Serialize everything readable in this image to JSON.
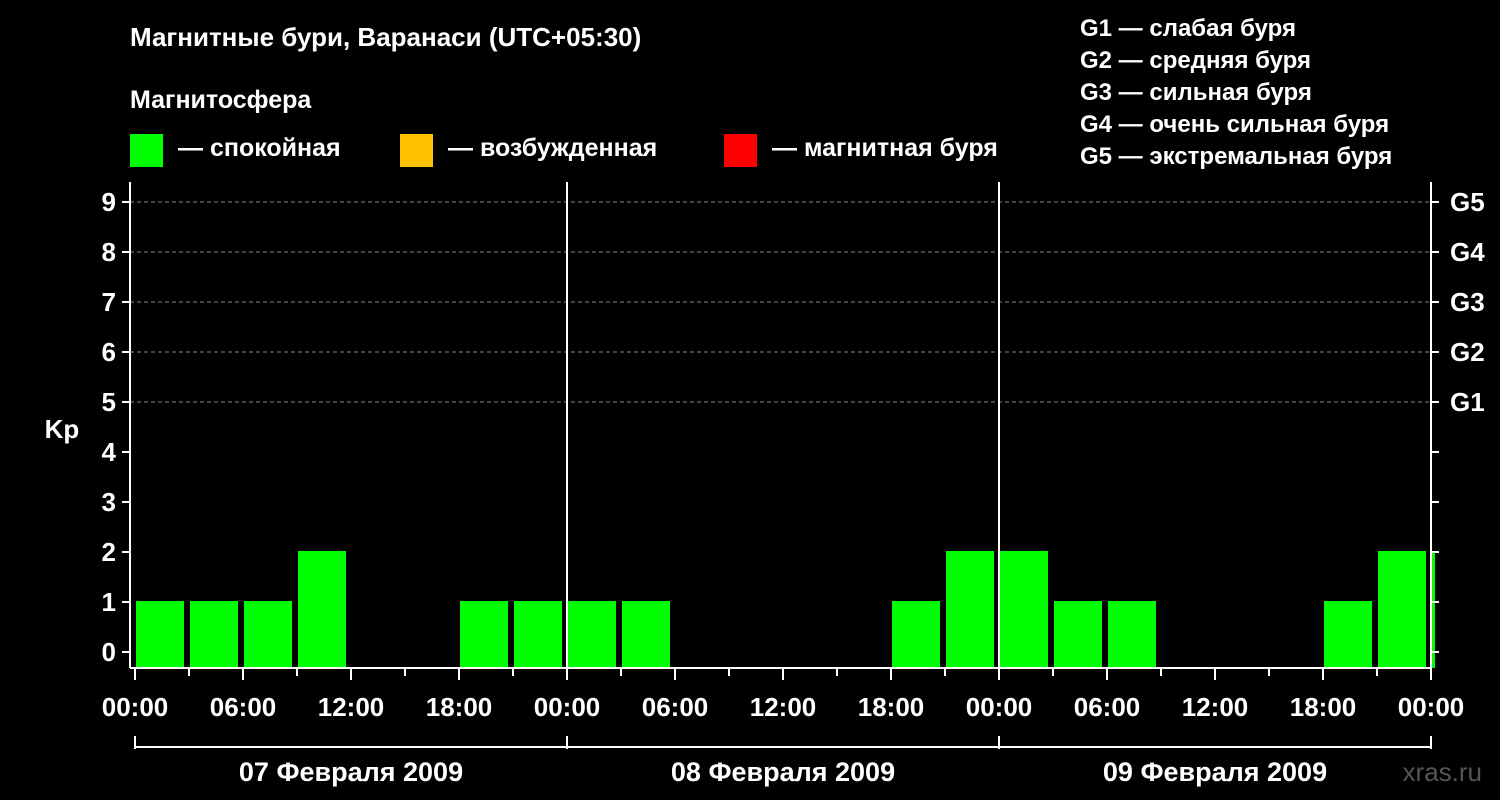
{
  "title": "Магнитные бури, Варанаси (UTC+05:30)",
  "legend": {
    "heading": "Магнитосфера",
    "items": [
      {
        "label": "— спокойная",
        "color": "#00ff00"
      },
      {
        "label": "— возбужденная",
        "color": "#ffc000"
      },
      {
        "label": "— магнитная буря",
        "color": "#ff0000"
      }
    ]
  },
  "g_legend": [
    "G1 — слабая буря",
    "G2 — средняя буря",
    "G3 — сильная буря",
    "G4 — очень сильная буря",
    "G5 — экстремальная буря"
  ],
  "watermark": "xras.ru",
  "chart_data": {
    "type": "bar",
    "ylabel": "Kp",
    "ylim": [
      0,
      9
    ],
    "y_ticks": [
      "0",
      "1",
      "2",
      "3",
      "4",
      "5",
      "6",
      "7",
      "8",
      "9"
    ],
    "right_ticks": [
      {
        "kp": 5,
        "label": "G1"
      },
      {
        "kp": 6,
        "label": "G2"
      },
      {
        "kp": 7,
        "label": "G3"
      },
      {
        "kp": 8,
        "label": "G4"
      },
      {
        "kp": 9,
        "label": "G5"
      }
    ],
    "x_ticks": [
      "00:00",
      "06:00",
      "12:00",
      "18:00",
      "00:00",
      "06:00",
      "12:00",
      "18:00",
      "00:00",
      "06:00",
      "12:00",
      "18:00",
      "00:00"
    ],
    "days": [
      "07 Февраля 2009",
      "08 Февраля 2009",
      "09 Февраля 2009"
    ],
    "grid": "dashed horizontal at Kp 5-9",
    "bar_color": "#00ff00",
    "bars": [
      {
        "start": "07 Февраля 2009 00:00",
        "end": "07 Февраля 2009 03:00",
        "kp": 1
      },
      {
        "start": "07 Февраля 2009 03:00",
        "end": "07 Февраля 2009 06:00",
        "kp": 1
      },
      {
        "start": "07 Февраля 2009 06:00",
        "end": "07 Февраля 2009 09:00",
        "kp": 1
      },
      {
        "start": "07 Февраля 2009 09:00",
        "end": "07 Февраля 2009 12:00",
        "kp": 2
      },
      {
        "start": "07 Февраля 2009 18:00",
        "end": "07 Февраля 2009 21:00",
        "kp": 1
      },
      {
        "start": "07 Февраля 2009 21:00",
        "end": "08 Февраля 2009 00:00",
        "kp": 1
      },
      {
        "start": "08 Февраля 2009 00:00",
        "end": "08 Февраля 2009 03:00",
        "kp": 1
      },
      {
        "start": "08 Февраля 2009 03:00",
        "end": "08 Февраля 2009 06:00",
        "kp": 1
      },
      {
        "start": "08 Февраля 2009 18:00",
        "end": "08 Февраля 2009 21:00",
        "kp": 1
      },
      {
        "start": "08 Февраля 2009 21:00",
        "end": "09 Февраля 2009 00:00",
        "kp": 2
      },
      {
        "start": "09 Февраля 2009 00:00",
        "end": "09 Февраля 2009 03:00",
        "kp": 2
      },
      {
        "start": "09 Февраля 2009 03:00",
        "end": "09 Февраля 2009 06:00",
        "kp": 1
      },
      {
        "start": "09 Февраля 2009 06:00",
        "end": "09 Февраля 2009 09:00",
        "kp": 1
      },
      {
        "start": "09 Февраля 2009 18:00",
        "end": "09 Февраля 2009 21:00",
        "kp": 1
      },
      {
        "start": "09 Февраля 2009 21:00",
        "end": "10 Февраля 2009 00:00",
        "kp": 2
      },
      {
        "start": "10 Февраля 2009 00:00",
        "end": "10 Февраля 2009 00:30",
        "kp": 2
      }
    ]
  }
}
